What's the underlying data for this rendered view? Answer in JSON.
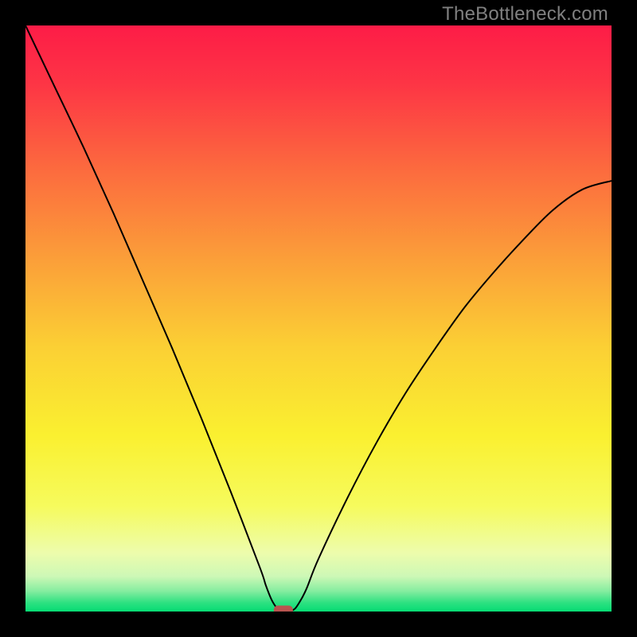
{
  "watermark": "TheBottleneck.com",
  "chart_data": {
    "type": "line",
    "title": "",
    "xlabel": "",
    "ylabel": "",
    "xlim": [
      0,
      100
    ],
    "ylim": [
      0,
      100
    ],
    "grid": false,
    "legend": false,
    "series": [
      {
        "name": "bottleneck-curve",
        "color": "#000000",
        "x": [
          0,
          5,
          10,
          15,
          20,
          25,
          30,
          35,
          40,
          41,
          42,
          43,
          44,
          45,
          46,
          47,
          48,
          50,
          55,
          60,
          65,
          70,
          75,
          80,
          85,
          90,
          95,
          100
        ],
        "y": [
          100,
          89.5,
          79,
          68,
          56.5,
          45,
          33,
          20.5,
          7.5,
          4.5,
          2.0,
          0.5,
          0.0,
          0.0,
          0.5,
          2.0,
          4.0,
          9.0,
          19.5,
          29.0,
          37.5,
          45.0,
          52.0,
          58.0,
          63.5,
          68.5,
          72.0,
          73.5
        ]
      }
    ],
    "marker": {
      "name": "optimal-point",
      "x": 44,
      "y": 0,
      "color": "#b85450",
      "shape": "rounded"
    },
    "background_gradient": {
      "type": "vertical",
      "stops": [
        {
          "offset": 0.0,
          "color": "#fd1c47"
        },
        {
          "offset": 0.1,
          "color": "#fd3545"
        },
        {
          "offset": 0.25,
          "color": "#fc6c3e"
        },
        {
          "offset": 0.4,
          "color": "#fb9f39"
        },
        {
          "offset": 0.55,
          "color": "#fbd034"
        },
        {
          "offset": 0.7,
          "color": "#faf030"
        },
        {
          "offset": 0.82,
          "color": "#f6fb5d"
        },
        {
          "offset": 0.9,
          "color": "#edfcac"
        },
        {
          "offset": 0.94,
          "color": "#cdf8b6"
        },
        {
          "offset": 0.965,
          "color": "#85eda0"
        },
        {
          "offset": 0.985,
          "color": "#2de181"
        },
        {
          "offset": 1.0,
          "color": "#06dc74"
        }
      ]
    }
  }
}
